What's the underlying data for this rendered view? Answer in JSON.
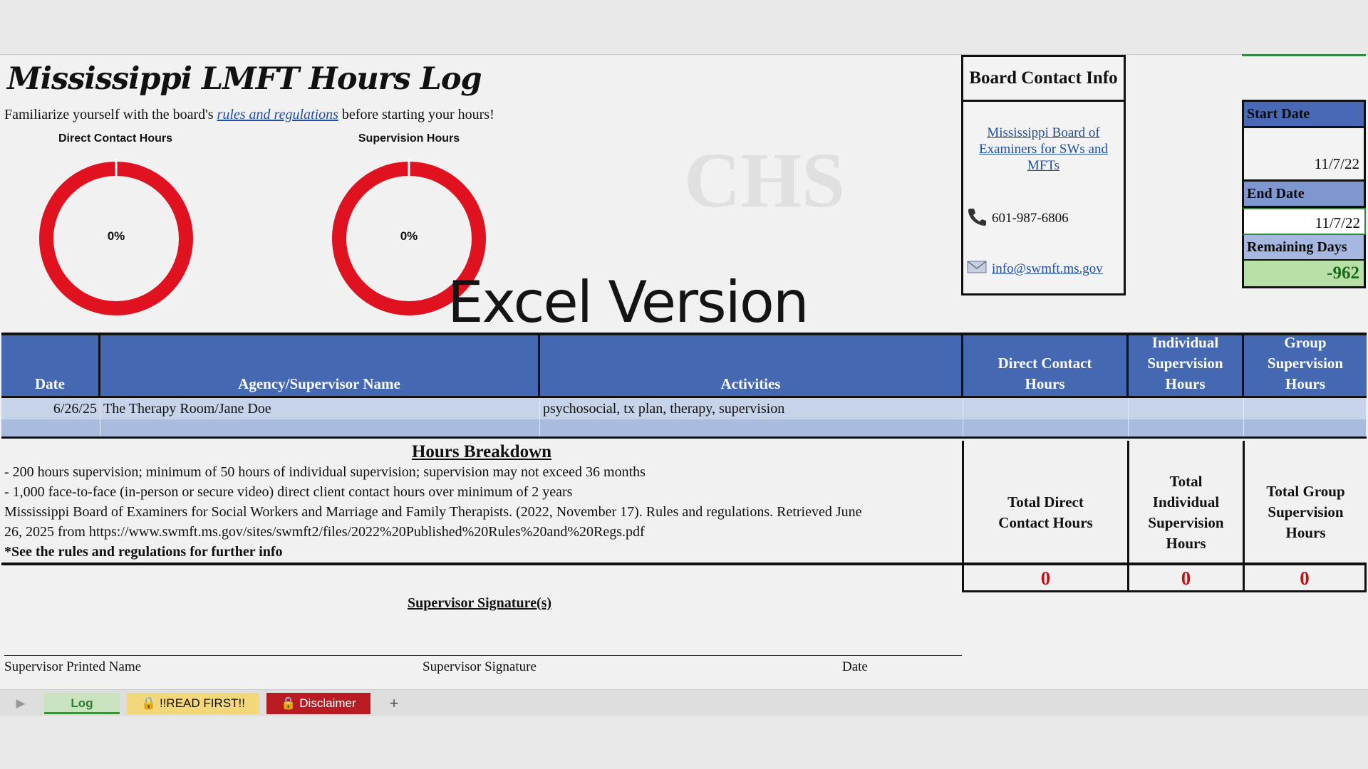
{
  "title": "Mississippi LMFT Hours Log",
  "intro": {
    "before": "Familiarize yourself with the board's ",
    "link": "rules and regulations",
    "after": " before starting your hours!"
  },
  "gauges": [
    {
      "label": "Direct Contact Hours",
      "value_text": "0%",
      "fraction": 0
    },
    {
      "label": "Supervision Hours",
      "value_text": "0%",
      "fraction": 0
    }
  ],
  "watermark": "Excel Version",
  "contact": {
    "heading": "Board Contact Info",
    "link": "Mississippi Board of Examiners for SWs and MFTs",
    "phone": "601-987-6806",
    "email": "info@swmft.ms.gov",
    "phone_icon": "phone-icon",
    "email_icon": "email-icon"
  },
  "dates": {
    "start_label": "Start Date",
    "start_value": "11/7/22",
    "end_label": "End Date",
    "end_value": "11/7/22",
    "remaining_label": "Remaining Days",
    "remaining_value": "-962"
  },
  "table": {
    "headers": {
      "date": "Date",
      "agency": "Agency/Supervisor Name",
      "activities": "Activities",
      "direct": "Direct Contact Hours",
      "individual": "Individual Supervision Hours",
      "group": "Group Supervision Hours"
    },
    "rows": [
      {
        "date": "6/26/25",
        "agency": "The Therapy Room/Jane Doe",
        "activities": "psychosocial, tx plan, therapy, supervision",
        "direct": "",
        "individual": "",
        "group": ""
      }
    ]
  },
  "breakdown": {
    "title": "Hours Breakdown",
    "line1": "- 200 hours supervision; minimum of 50 hours of individual supervision; supervision may not exceed 36 months",
    "line2": "- 1,000 face-to-face (in-person or secure video) direct client contact hours over minimum of 2 years",
    "line3": "Mississippi Board of Examiners for Social Workers and Marriage and Family Therapists. (2022, November 17). Rules and regulations. Retrieved June",
    "line4": "26, 2025 from https://www.swmft.ms.gov/sites/swmft2/files/2022%20Published%20Rules%20and%20Regs.pdf",
    "line5": "*See the rules and regulations for further info"
  },
  "totals": {
    "direct_label": "Total Direct Contact Hours",
    "individual_label": "Total Individual Supervision Hours",
    "group_label": "Total Group Supervision Hours",
    "direct_value": "0",
    "individual_value": "0",
    "group_value": "0"
  },
  "signature": {
    "title": "Supervisor Signature(s)",
    "printed_name": "Supervisor Printed Name",
    "signature": "Supervisor Signature",
    "date": "Date"
  },
  "tabs": {
    "log": "Log",
    "read_first": "!!READ FIRST!!",
    "disclaimer": "Disclaimer",
    "add": "+"
  },
  "colors": {
    "header_blue": "#4468b1",
    "gauge_red": "#e0121f",
    "total_red": "#c1121b",
    "remaining_green": "#b8e0a6",
    "tab_log": "#c9e3bf",
    "tab_read_first": "#f3d77b",
    "tab_disclaimer": "#b81c22"
  }
}
